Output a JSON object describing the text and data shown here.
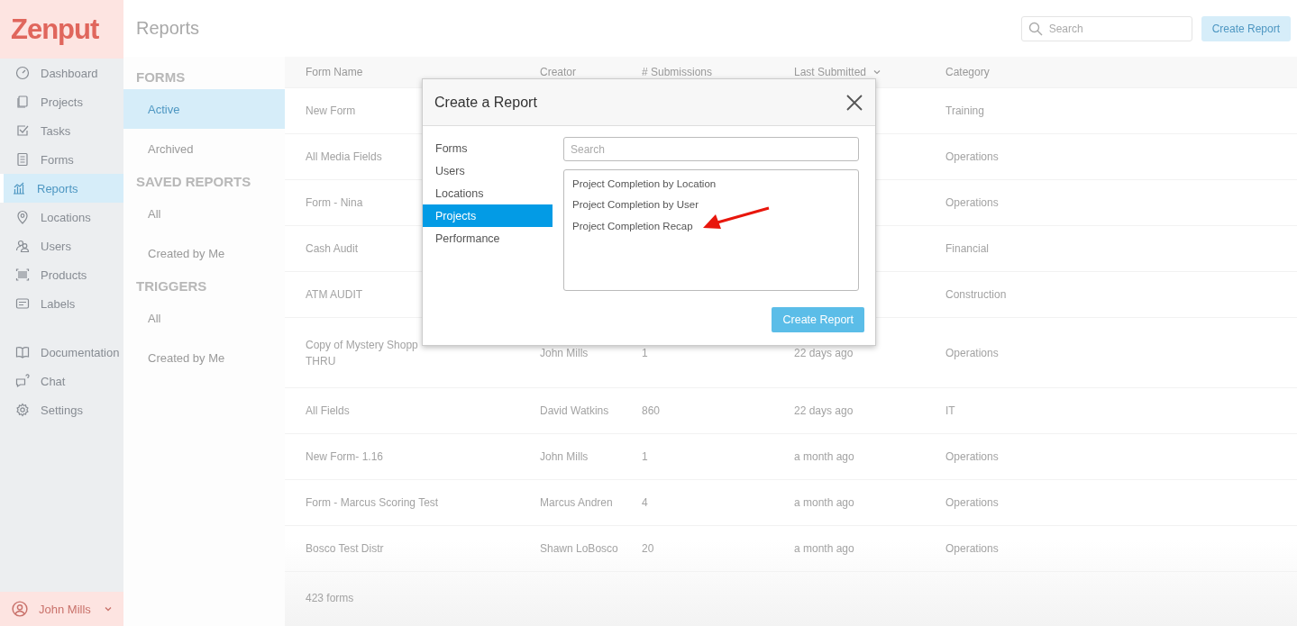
{
  "sidebar": {
    "logo": "Zenput",
    "items": [
      {
        "label": "Dashboard",
        "selected": false
      },
      {
        "label": "Projects",
        "selected": false
      },
      {
        "label": "Tasks",
        "selected": false
      },
      {
        "label": "Forms",
        "selected": false
      },
      {
        "label": "Reports",
        "selected": true
      },
      {
        "label": "Locations",
        "selected": false
      },
      {
        "label": "Users",
        "selected": false
      },
      {
        "label": "Products",
        "selected": false
      },
      {
        "label": "Labels",
        "selected": false
      }
    ],
    "help_items": [
      {
        "label": "Documentation"
      },
      {
        "label": "Chat"
      },
      {
        "label": "Settings"
      }
    ],
    "user": "John Mills"
  },
  "page_title": "Reports",
  "toolbar": {
    "search": {
      "placeholder": "Search"
    },
    "button": "Create Report"
  },
  "subnav": [
    {
      "heading": "FORMS",
      "items": [
        {
          "label": "Active",
          "selected": true
        },
        {
          "label": "Archived",
          "selected": false
        }
      ]
    },
    {
      "heading": "SAVED REPORTS",
      "items": [
        {
          "label": "All",
          "selected": false
        },
        {
          "label": "Created by Me",
          "selected": false
        }
      ]
    },
    {
      "heading": "TRIGGERS",
      "items": [
        {
          "label": "All",
          "selected": false
        },
        {
          "label": "Created by Me",
          "selected": false
        }
      ]
    }
  ],
  "table": {
    "columns": [
      {
        "label": "Form Name",
        "sorted": false
      },
      {
        "label": "Creator",
        "sorted": false
      },
      {
        "label": "# Submissions",
        "sorted": false
      },
      {
        "label": "Last Submitted",
        "sorted": true
      },
      {
        "label": "Category",
        "sorted": false
      }
    ],
    "rows": [
      {
        "form_name": "New Form",
        "category": "Training"
      },
      {
        "form_name": "All Media Fields",
        "category": "Operations"
      },
      {
        "form_name": "Form - Nina",
        "category": "Operations"
      },
      {
        "form_name": "Cash Audit",
        "category": "Financial"
      },
      {
        "form_name": "ATM AUDIT",
        "category": "Construction"
      },
      {
        "form_name": "Copy of Mystery Shopp\nTHRU",
        "creator": "John Mills",
        "submissions": "1",
        "last_submitted": "22 days ago",
        "category": "Operations"
      },
      {
        "form_name": "All Fields",
        "creator": "David Watkins",
        "submissions": "860",
        "last_submitted": "22 days ago",
        "category": "IT"
      },
      {
        "form_name": "New Form- 1.16",
        "creator": "John Mills",
        "submissions": "1",
        "last_submitted": "a month ago",
        "category": "Operations"
      },
      {
        "form_name": "Form - Marcus Scoring Test",
        "creator": "Marcus Andren",
        "submissions": "4",
        "last_submitted": "a month ago",
        "category": "Operations"
      },
      {
        "form_name": "Bosco Test Distr",
        "creator": "Shawn LoBosco",
        "submissions": "20",
        "last_submitted": "a month ago",
        "category": "Operations"
      }
    ],
    "footer": "423 forms"
  },
  "modal": {
    "title": "Create a Report",
    "categories": [
      {
        "label": "Forms",
        "selected": false
      },
      {
        "label": "Users",
        "selected": false
      },
      {
        "label": "Locations",
        "selected": false
      },
      {
        "label": "Projects",
        "selected": true
      },
      {
        "label": "Performance",
        "selected": false
      }
    ],
    "search": {
      "placeholder": "Search"
    },
    "reports": [
      "Project Completion by Location",
      "Project Completion by User",
      "Project Completion Recap"
    ],
    "button": "Create Report"
  }
}
